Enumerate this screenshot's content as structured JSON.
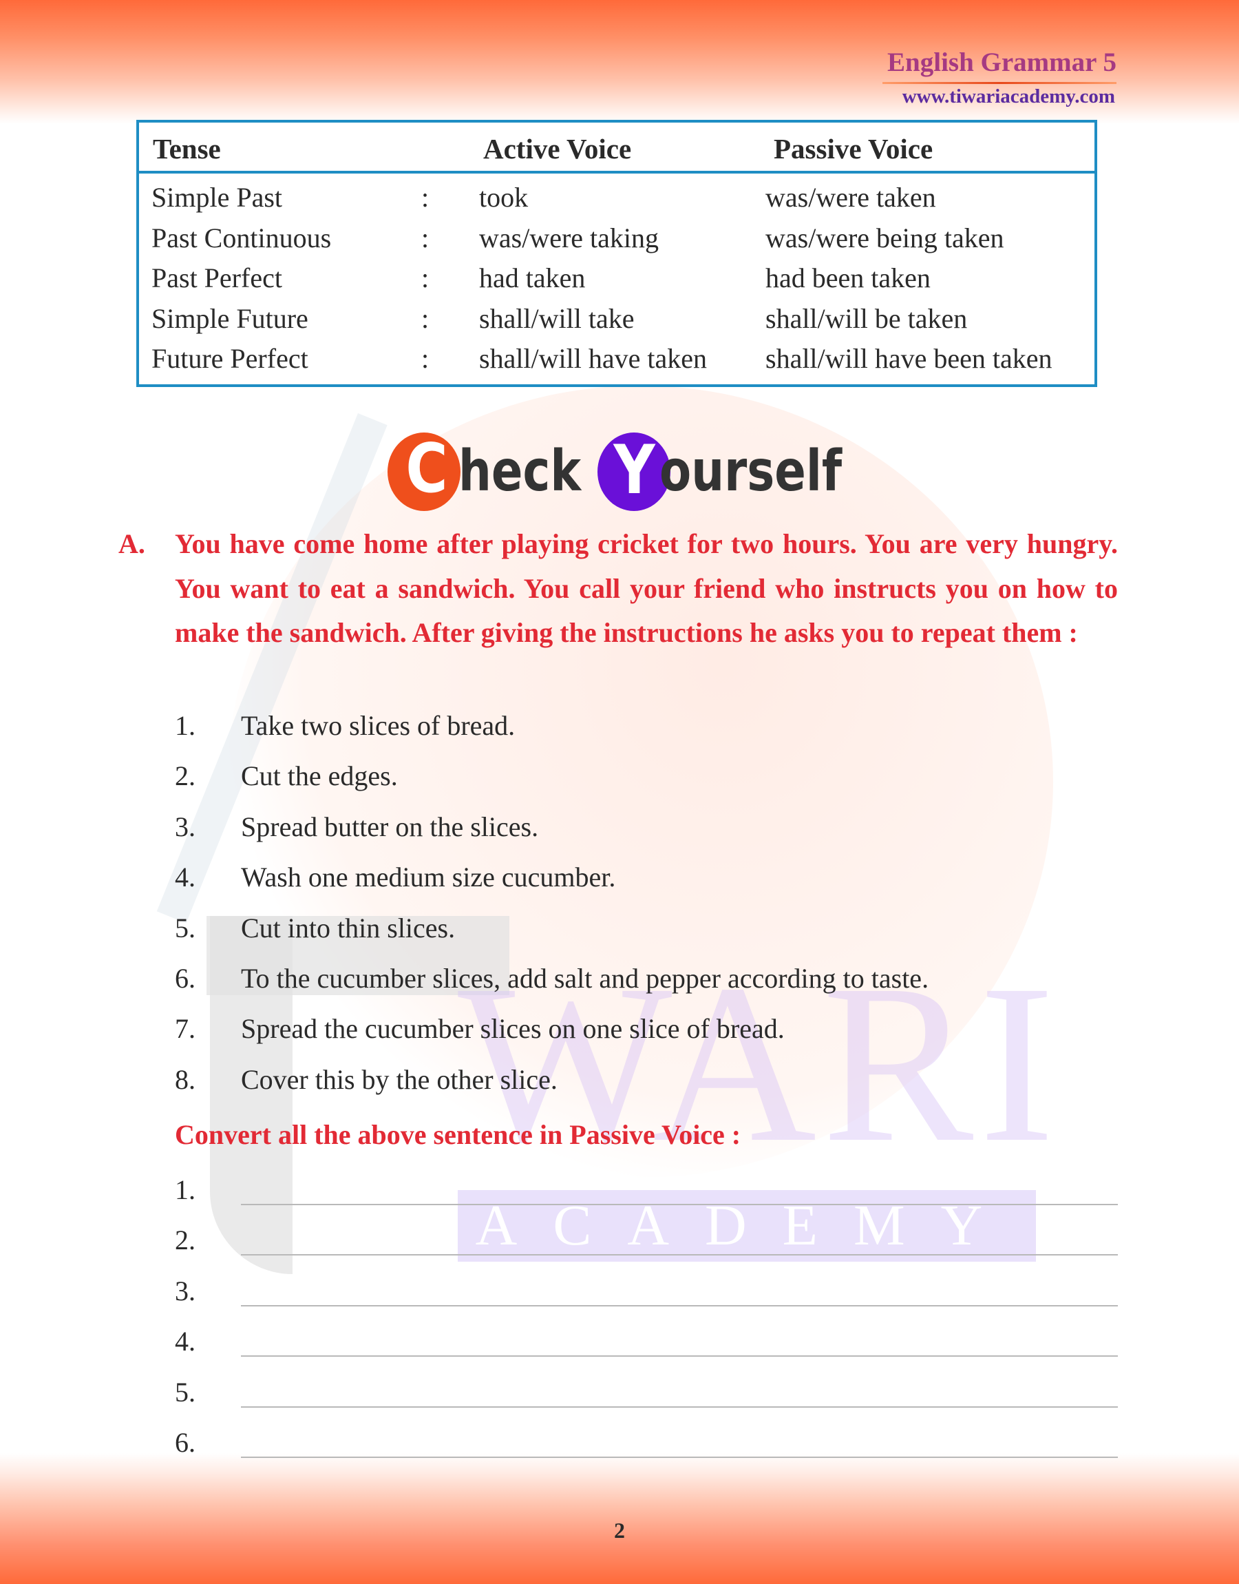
{
  "header": {
    "title": "English Grammar 5",
    "url": "www.tiwariacademy.com"
  },
  "colors": {
    "accent_red": "#e22a35",
    "header_purple": "#a53a82",
    "url_purple": "#5b2ca0",
    "table_border": "#1f8ec4",
    "check_c_circle": "#ef4f1c",
    "check_y_circle": "#6a10d8",
    "band_orange": "#ff6a3a"
  },
  "tense_table": {
    "headers": [
      "Tense",
      "Active Voice",
      "Passive Voice"
    ],
    "separator": ":",
    "rows": [
      {
        "tense": "Simple Past",
        "active": "took",
        "passive": "was/were taken"
      },
      {
        "tense": "Past Continuous",
        "active": "was/were taking",
        "passive": "was/were being taken"
      },
      {
        "tense": "Past Perfect",
        "active": "had taken",
        "passive": "had been taken"
      },
      {
        "tense": "Simple Future",
        "active": "shall/will take",
        "passive": "shall/will be taken"
      },
      {
        "tense": "Future Perfect",
        "active": "shall/will have taken",
        "passive": "shall/will have been taken"
      }
    ]
  },
  "check_yourself": {
    "first_initial": "C",
    "first_rest": "heck",
    "second_initial": "Y",
    "second_rest": "ourself"
  },
  "question": {
    "label": "A.",
    "text": "You have come home after playing cricket for two hours. You are very hungry. You want to eat a sandwich. You call your friend who instructs you on how to make the sandwich. After giving the instructions he asks you to repeat them :",
    "steps": [
      {
        "num": "1.",
        "text": "Take two slices of bread."
      },
      {
        "num": "2.",
        "text": "Cut the edges."
      },
      {
        "num": "3.",
        "text": "Spread butter on the slices."
      },
      {
        "num": "4.",
        "text": "Wash one medium size cucumber."
      },
      {
        "num": "5.",
        "text": "Cut into thin slices."
      },
      {
        "num": "6.",
        "text": "To the cucumber slices, add salt and pepper according to taste."
      },
      {
        "num": "7.",
        "text": "Spread the cucumber slices on one slice of bread."
      },
      {
        "num": "8.",
        "text": "Cover this by the other slice."
      }
    ],
    "convert_heading": "Convert all the above sentence in Passive Voice :",
    "answers": [
      {
        "num": "1.",
        "value": ""
      },
      {
        "num": "2.",
        "value": ""
      },
      {
        "num": "3.",
        "value": ""
      },
      {
        "num": "4.",
        "value": ""
      },
      {
        "num": "5.",
        "value": ""
      },
      {
        "num": "6.",
        "value": ""
      }
    ]
  },
  "watermark": {
    "line1": "WARI",
    "line2": "ACADEMY"
  },
  "footer": {
    "page_number": "2"
  }
}
